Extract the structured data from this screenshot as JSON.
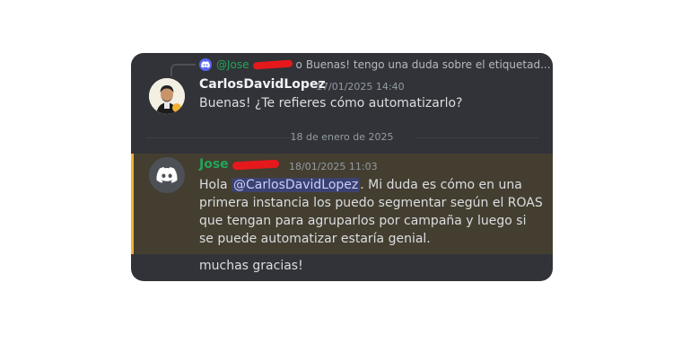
{
  "reply_ref": {
    "author": "@Jose",
    "after_redaction": "o",
    "preview": "Buenas! tengo una duda sobre el etiquetad..."
  },
  "message1": {
    "author": "CarlosDavidLopez",
    "timestamp": "17/01/2025 14:40",
    "text": "Buenas! ¿Te refieres cómo automatizarlo?"
  },
  "date_divider": "18 de enero de 2025",
  "message2": {
    "author": "Jose",
    "timestamp": "18/01/2025 11:03",
    "text_before_mention": "Hola ",
    "mention": "@CarlosDavidLopez",
    "text_after_mention": ". Mi duda es cómo en una primera instancia los puedo segmentar según el ROAS que tengan para agruparlos por campaña y luego si se puede automatizar estaría genial."
  },
  "message3": {
    "text": "muchas gracias!"
  },
  "colors": {
    "background": "#313338",
    "mention_highlight": "#433e30",
    "highlight_bar": "#f0b232",
    "username_green": "#23a559",
    "redaction": "#e5191c"
  },
  "icons": {
    "reply_avatar": "discord-logo-icon",
    "author_avatar": "discord-logo-icon"
  }
}
